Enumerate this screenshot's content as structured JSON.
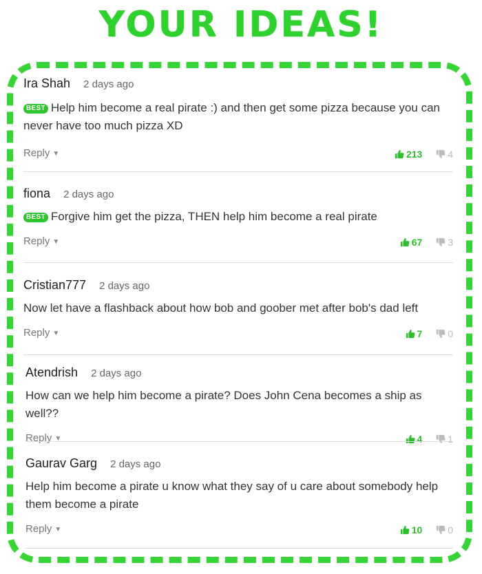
{
  "header": {
    "title": "YOUR IDEAS!"
  },
  "comments": [
    {
      "author": "Ira Shah",
      "time": "2 days ago",
      "best": "BEST",
      "text": "Help him become a real pirate :) and then get some pizza because you can never have too much pizza XD",
      "reply": "Reply",
      "upvotes": "213",
      "downvotes": "4"
    },
    {
      "author": "fiona",
      "time": "2 days ago",
      "best": "BEST",
      "text": "Forgive him get the pizza, THEN help him become a real pirate",
      "reply": "Reply",
      "upvotes": "67",
      "downvotes": "3"
    },
    {
      "author": "Cristian777",
      "time": "2 days ago",
      "text": "Now let have a flashback about how bob and goober met after bob's dad left",
      "reply": "Reply",
      "upvotes": "7",
      "downvotes": "0"
    },
    {
      "author": "Atendrish",
      "time": "2 days ago",
      "text": "How can we help him become a pirate? Does John Cena becomes a ship as well??",
      "reply": "Reply",
      "upvotes": "4",
      "downvotes": "1"
    },
    {
      "author": "Gaurav Garg",
      "time": "2 days ago",
      "text": "Help him become a pirate u know what they say of u care about somebody help them become a pirate",
      "reply": "Reply",
      "upvotes": "10",
      "downvotes": "0"
    }
  ],
  "colors": {
    "accent": "#2fd12f",
    "upvote": "#2cbf2c",
    "downvote": "#bbbbbb"
  },
  "icons": {
    "upvote": "thumbs-up-icon",
    "downvote": "thumbs-down-icon",
    "reply_caret": "caret-down-icon"
  }
}
